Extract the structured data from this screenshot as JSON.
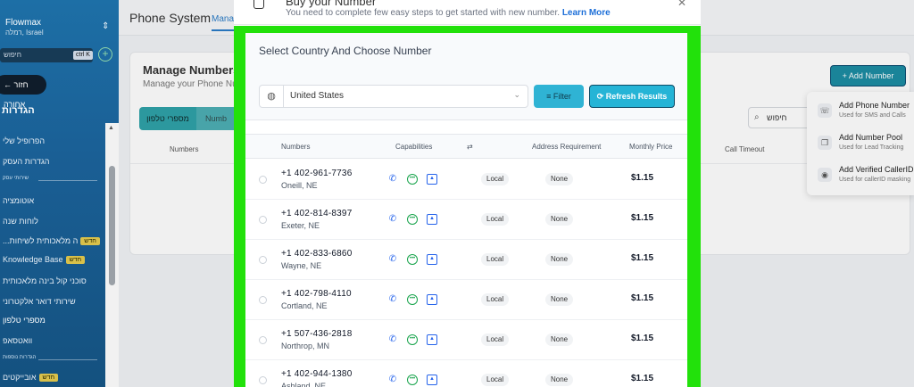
{
  "sidebar": {
    "brand": "Flowmax",
    "subtitle": "רמלה, Israel",
    "search_placeholder": "חיפוש",
    "search_shortcut": "ctrl K",
    "back_label": "חזור אחורה",
    "section_title": "הגדרות",
    "items": [
      {
        "label": "הפרופיל שלי",
        "top": 0
      },
      {
        "label": "הגדרות העסק",
        "top": 0
      },
      {
        "label": "אוטומציה",
        "top": 0
      },
      {
        "label": "לוחות שנה",
        "top": 0
      },
      {
        "label": "...ה מלאכותית לשיחות",
        "badge": "חדש"
      },
      {
        "label": "Knowledge Base",
        "badge": "חדש"
      },
      {
        "label": "סוכני קול בינה מלאכותית"
      },
      {
        "label": "שירותי דואר אלקטרוני"
      },
      {
        "label": "מספרי טלפון"
      },
      {
        "label": "וואטסאפ"
      },
      {
        "label": "אובייקטים",
        "badge": "חדש"
      }
    ],
    "divider1": "שירותי עסק",
    "divider2": "הגדרות נוספות"
  },
  "background": {
    "page_title": "Phone System",
    "active_tab": "Mana",
    "card_title": "Manage Numbers",
    "card_subtitle": "Manage your Phone Nu",
    "pill1": "מספרי טלפון",
    "pill2": "Numb",
    "col_numbers": "Numbers",
    "col_call_timeout": "Call Timeout",
    "search_placeholder": "חיפוש",
    "add_number_label": "Add Number",
    "menu": [
      {
        "title": "Add Phone Number",
        "subtitle": "Used for SMS and Calls"
      },
      {
        "title": "Add Number Pool",
        "subtitle": "Used for Lead Tracking"
      },
      {
        "title": "Add Verified CallerID",
        "subtitle": "Used for callerID masking"
      }
    ]
  },
  "modal": {
    "title": "Buy your Number",
    "description": "You need to complete few easy steps to get started with new number.",
    "learn_more": "Learn More",
    "panel_title": "Select Country And Choose Number",
    "country": "United States",
    "filter_label": "Filter",
    "refresh_label": "Refresh Results",
    "columns": {
      "numbers": "Numbers",
      "capabilities": "Capabilities",
      "type_icon": "⇄",
      "address": "Address Requirement",
      "price": "Monthly Price"
    },
    "rows": [
      {
        "number": "+1 402-961-7736",
        "location": "Oneill, NE",
        "type": "Local",
        "address": "None",
        "price": "$1.15"
      },
      {
        "number": "+1 402-814-8397",
        "location": "Exeter, NE",
        "type": "Local",
        "address": "None",
        "price": "$1.15"
      },
      {
        "number": "+1 402-833-6860",
        "location": "Wayne, NE",
        "type": "Local",
        "address": "None",
        "price": "$1.15"
      },
      {
        "number": "+1 402-798-4110",
        "location": "Cortland, NE",
        "type": "Local",
        "address": "None",
        "price": "$1.15"
      },
      {
        "number": "+1 507-436-2818",
        "location": "Northrop, MN",
        "type": "Local",
        "address": "None",
        "price": "$1.15"
      },
      {
        "number": "+1 402-944-1380",
        "location": "Ashland, NE",
        "type": "Local",
        "address": "None",
        "price": "$1.15"
      }
    ]
  },
  "colors": {
    "highlight": "#22e10b",
    "accent": "#25b4d6",
    "sidebar": "#1a5f95"
  }
}
